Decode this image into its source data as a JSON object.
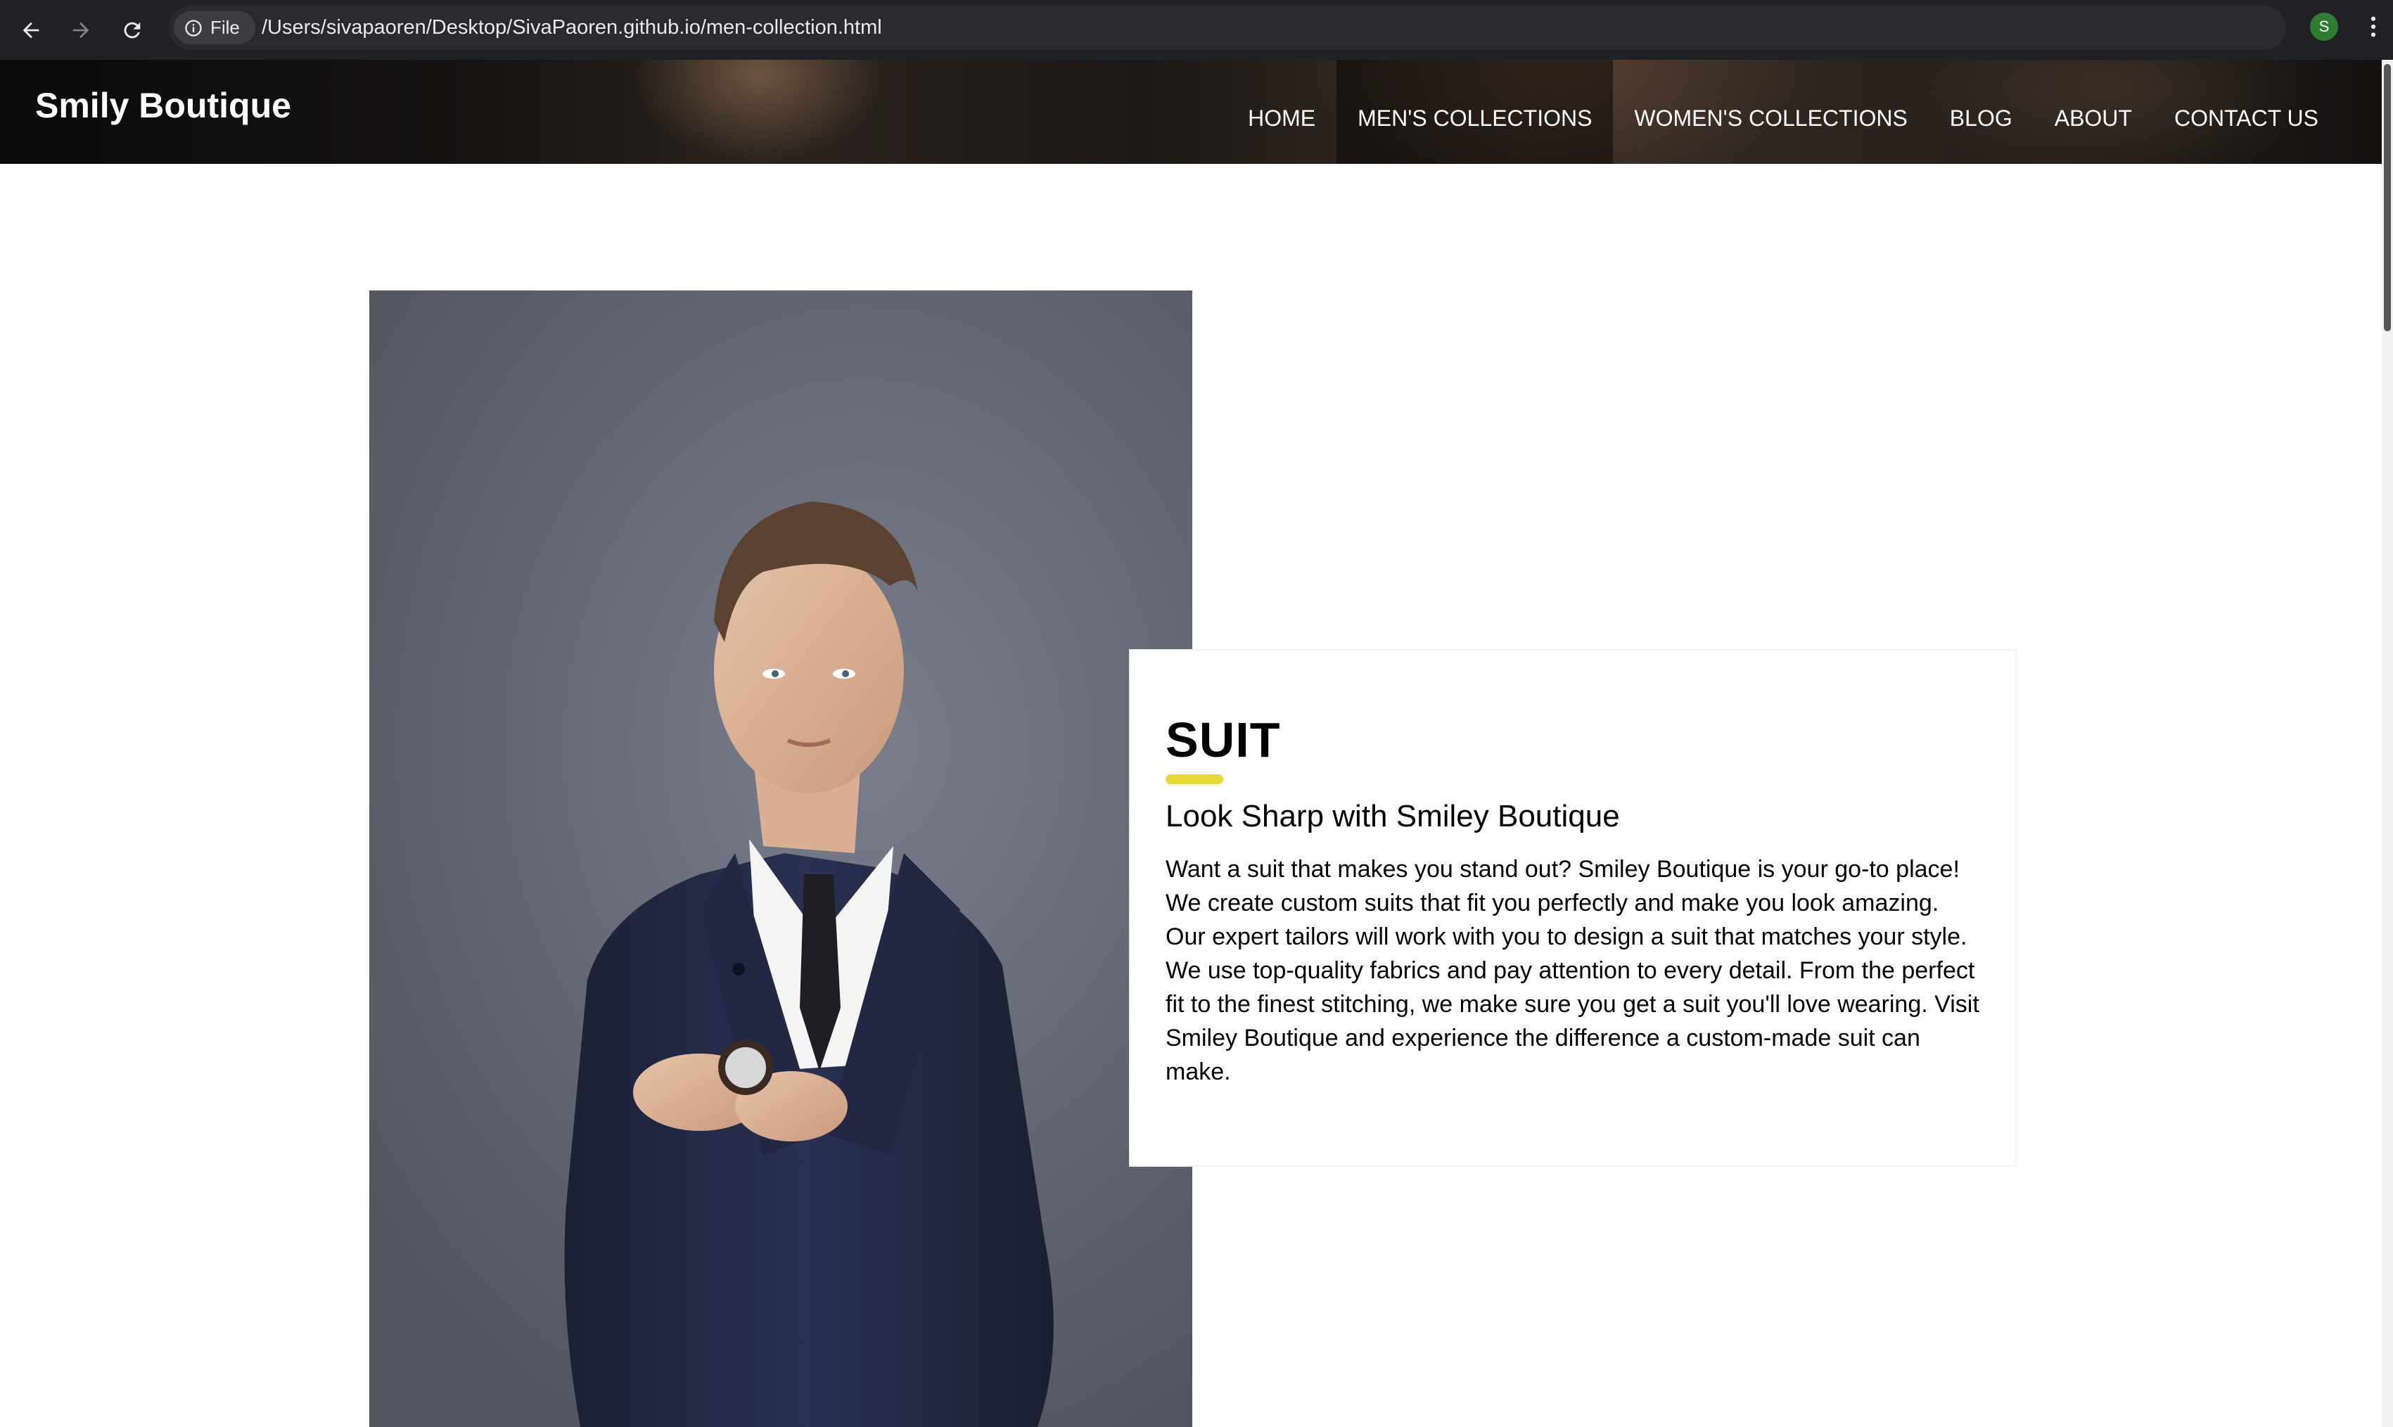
{
  "browser": {
    "file_chip_label": "File",
    "url": "/Users/sivapaoren/Desktop/SivaPaoren.github.io/men-collection.html",
    "profile_initial": "S"
  },
  "header": {
    "brand": "Smily Boutique",
    "nav": [
      {
        "label": "HOME",
        "active": false
      },
      {
        "label": "MEN'S COLLECTIONS",
        "active": true
      },
      {
        "label": "WOMEN'S COLLECTIONS",
        "active": false
      },
      {
        "label": "BLOG",
        "active": false
      },
      {
        "label": "ABOUT",
        "active": false
      },
      {
        "label": "CONTACT US",
        "active": false
      }
    ]
  },
  "product": {
    "title": "SUIT",
    "subtitle": "Look Sharp with Smiley Boutique",
    "description": "Want a suit that makes you stand out? Smiley Boutique is your go-to place! We create custom suits that fit you perfectly and make you look amazing. Our expert tailors will work with you to design a suit that matches your style. We use top-quality fabrics and pay attention to every detail. From the perfect fit to the finest stitching, we make sure you get a suit you'll love wearing. Visit Smiley Boutique and experience the difference a custom-made suit can make."
  },
  "colors": {
    "accent": "#e6d93a",
    "chrome": "#202124",
    "suit": "#232a45"
  },
  "icons": [
    "back-arrow-icon",
    "forward-arrow-icon",
    "reload-icon",
    "info-icon",
    "star-icon",
    "kebab-menu-icon"
  ]
}
